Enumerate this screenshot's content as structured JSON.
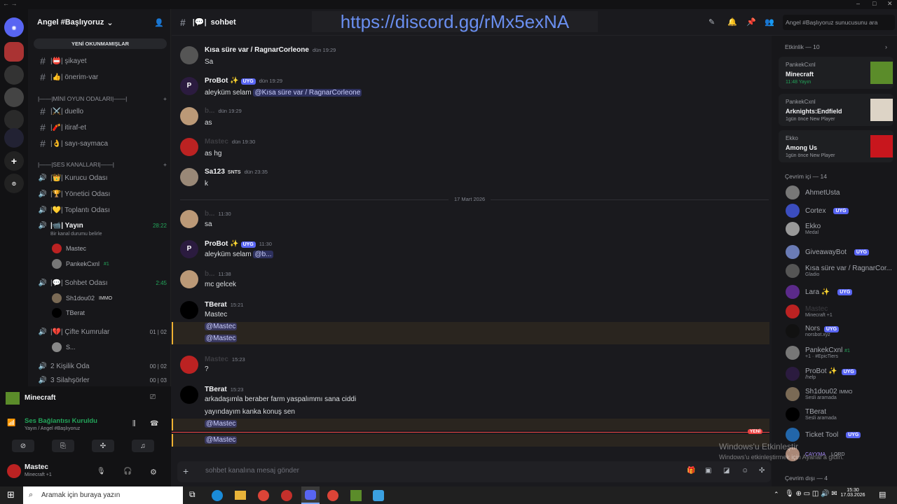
{
  "server": {
    "name": "Angel #Başlıyoruz",
    "unread_button": "YENİ OKUNMAMIŞLAR",
    "invite_link": "https://discord.gg/rMx5exNA"
  },
  "sidebar": {
    "text_channels": [
      {
        "label": "|📛| şikayet"
      },
      {
        "label": "|👍| önerim-var"
      }
    ],
    "category_games": "|——|MİNİ OYUN ODALARI|——|",
    "game_channels": [
      {
        "label": "|⚔️| duello"
      },
      {
        "label": "|🧨| itiraf-et"
      },
      {
        "label": "|👌| sayı-saymaca"
      }
    ],
    "category_voice": "|——|SES KANALLARI|——|",
    "voice_channels": [
      {
        "label": "|👑| Kurucu Odası",
        "counter": ""
      },
      {
        "label": "|🏆| Yönetici Odası",
        "counter": ""
      },
      {
        "label": "|💛| Toplantı Odası",
        "counter": ""
      },
      {
        "label": "|📹| Yayın",
        "counter": "28:22",
        "status": "Bir kanal durumu belirle"
      },
      {
        "label": "|💬| Sohbet Odası",
        "counter": "2:45"
      },
      {
        "label": "|💔| Çifte Kumrular",
        "counter_a": "01",
        "counter_b": "02"
      },
      {
        "label": "2 Kişilik Oda",
        "counter_a": "00",
        "counter_b": "02"
      },
      {
        "label": "3 Silahşörler",
        "counter_a": "00",
        "counter_b": "03"
      }
    ],
    "voice_users_yayin": [
      {
        "name": "Mastec"
      },
      {
        "name": "PankekCxnl",
        "tag": "#1"
      }
    ],
    "voice_users_sohbet": [
      {
        "name": "Sh1dou02",
        "tag": "IMMO"
      },
      {
        "name": "TBerat"
      }
    ],
    "voice_users_kumru": [
      {
        "name": "S..."
      }
    ]
  },
  "user_panel": {
    "game": "Minecraft",
    "voice_status": "Ses Bağlantısı Kuruldu",
    "voice_channel": "Yayın / Angel #Başlıyoruz",
    "username": "Mastec",
    "user_status": "Minecraft +1"
  },
  "channel": {
    "name": "sohbet",
    "input_placeholder": "sohbet kanalına mesaj gönder",
    "search_placeholder": "Angel #Başlıyoruz sunucusunu ara",
    "new_label": "YENİ"
  },
  "messages": [
    {
      "author": "Kısa süre var / RagnarCorleone",
      "time": "dün 19:29",
      "text": "Sa"
    },
    {
      "author": "ProBot ✨",
      "badge": "UYG",
      "time": "dün 19:29",
      "text": "aleyküm selam",
      "mention": "@Kısa süre var / RagnarCorleone"
    },
    {
      "author": "b...",
      "time": "dün 19:29",
      "text": "as"
    },
    {
      "author": "Mastec",
      "time": "dün 19:30",
      "text": "as hg"
    },
    {
      "author": "Sa123",
      "tag": "SNTS",
      "time": "dün 23:35",
      "text": "k"
    },
    {
      "date_divider": "17 Mart 2026"
    },
    {
      "author": "b...",
      "time": "11:30",
      "text": "sa"
    },
    {
      "author": "ProBot ✨",
      "badge": "UYG",
      "time": "11:30",
      "text": "aleyküm selam",
      "mention": "@b..."
    },
    {
      "author": "b...",
      "time": "11:38",
      "text": "mc gelcek"
    },
    {
      "author": "TBerat",
      "time": "15:21",
      "text": "Mastec",
      "mention1": "@Mastec",
      "mention2": "@Mastec"
    },
    {
      "author": "Mastec",
      "time": "15:23",
      "text": "?"
    },
    {
      "author": "TBerat",
      "time": "15:23",
      "text": "arkadaşımla beraber farm yaspalımmı sana ciddi",
      "text2": "yayındayım kanka konuş sen",
      "mention1": "@Mastec",
      "mention2": "@Mastec"
    }
  ],
  "members": {
    "activity_header": "Etkinlik — 10",
    "activities": [
      {
        "user": "PankekCxnl",
        "game": "Minecraft",
        "meta": "11:48 Yayın"
      },
      {
        "user": "PankekCxnl",
        "game": "Arknights:Endfield",
        "meta": "1gün önce New Player"
      },
      {
        "user": "Ekko",
        "game": "Among Us",
        "meta": "1gün önce New Player"
      }
    ],
    "online_header": "Çevrim içi — 14",
    "list": [
      {
        "name": "AhmetUsta",
        "sub": ""
      },
      {
        "name": "Cortex",
        "badge": "UYG",
        "sub": ""
      },
      {
        "name": "Ekko",
        "sub": "Medal"
      },
      {
        "name": "GiveawayBot",
        "badge": "UYG",
        "sub": ""
      },
      {
        "name": "Kısa süre var / RagnarCor...",
        "sub": "Gladio"
      },
      {
        "name": "Lara ✨",
        "badge": "UYG",
        "sub": ""
      },
      {
        "name": "Mastec",
        "sub": "Minecraft +1"
      },
      {
        "name": "Nors",
        "badge": "UYG",
        "sub": "norsbot.xyz"
      },
      {
        "name": "PankekCxnl",
        "tag": "#1",
        "sub": "+1 · #EpicTiers"
      },
      {
        "name": "ProBot ✨",
        "badge": "UYG",
        "sub": "/help"
      },
      {
        "name": "Sh1dou02",
        "tag": "IMMO",
        "sub": "Sesli aramada"
      },
      {
        "name": "TBerat",
        "sub": "Sesli aramada"
      },
      {
        "name": "Ticket Tool",
        "badge": "UYG",
        "sub": ""
      },
      {
        "name": "ÇAYYMA",
        "tag": "LORD",
        "sub": ""
      }
    ],
    "offline_header": "Çevrim dışı — 4"
  },
  "watermark": {
    "line1": "Windows'u Etkinleştir",
    "line2": "Windows'u etkinleştirmek için Ayarlar'a gidin."
  },
  "taskbar": {
    "search_placeholder": "Aramak için buraya yazın",
    "time": "15:30",
    "date": "17.03.2026"
  }
}
